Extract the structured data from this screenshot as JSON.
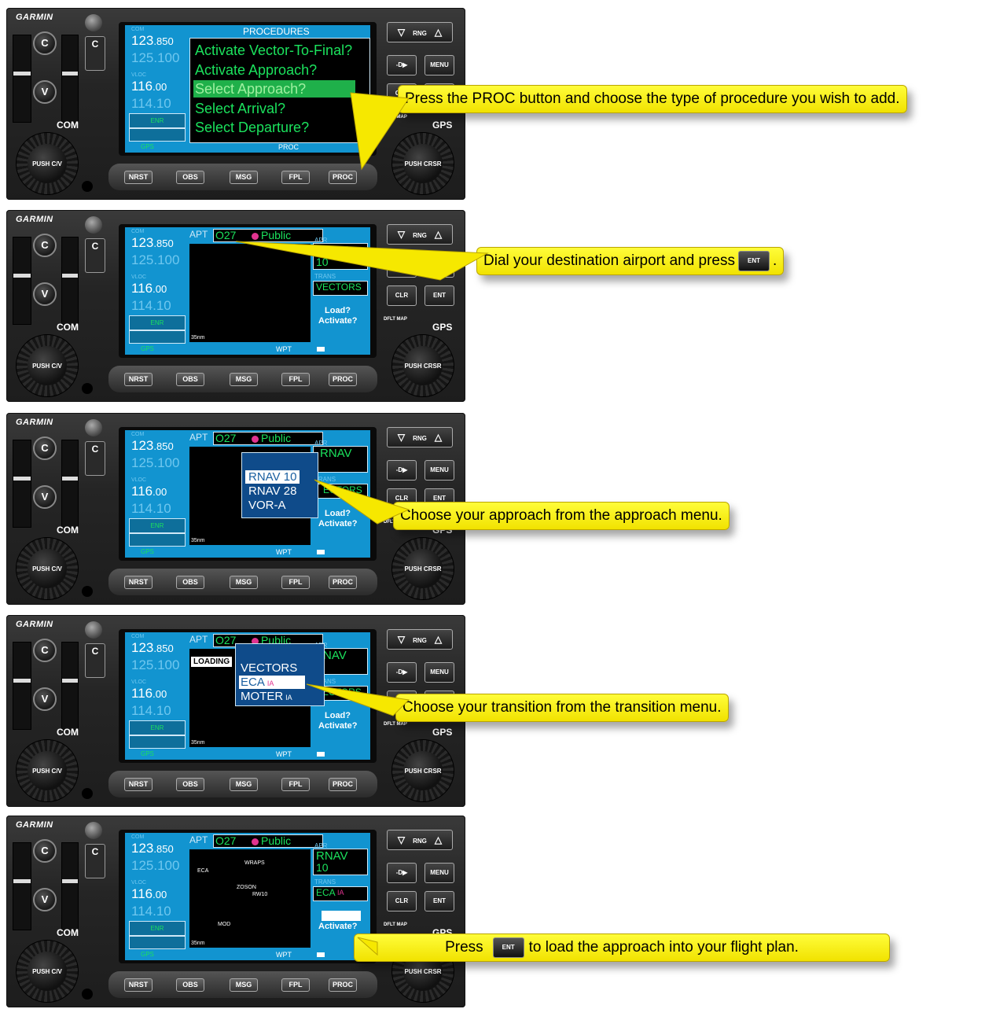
{
  "brand": "GARMIN",
  "labels": {
    "com": "COM",
    "gps": "GPS",
    "push_cv": "PUSH C/V",
    "push_crsr": "PUSH CRSR",
    "c_knob": "C",
    "v_knob": "V",
    "c_switch": "C",
    "rng": "RNG",
    "dto": "-D▶",
    "menu": "MENU",
    "clr": "CLR",
    "ent": "ENT",
    "dflt_map": "DFLT MAP",
    "com_small": "COM",
    "vloc_small": "VLOC",
    "enr": "ENR",
    "gps_small": "GPS",
    "apt": "APT",
    "public": "Public",
    "load": "Load?",
    "activate": "Activate?",
    "wpt": "WPT",
    "scale": "35nm",
    "proc_tab": "PROC",
    "apr": "APR",
    "trans": "TRANS",
    "loading": "LOADING"
  },
  "softkeys": [
    "NRST",
    "OBS",
    "MSG",
    "FPL",
    "PROC"
  ],
  "frequencies": {
    "com_active": "123",
    "com_active_dec": ".850",
    "com_standby": "125.100",
    "vloc_active": "116",
    "vloc_active_dec": ".00",
    "vloc_standby": "114.10"
  },
  "panel1": {
    "header": "PROCEDURES",
    "items": [
      "Activate Vector-To-Final?",
      "Activate Approach?",
      "Select Approach?",
      "Select Arrival?",
      "Select Departure?"
    ],
    "selected_index": 2,
    "callout": "Press the PROC button and choose the type of procedure you wish to add."
  },
  "panel2": {
    "airport": "O27",
    "approach": "RNAV",
    "approach_rwy": "10",
    "transition": "VECTORS",
    "callout_prefix": "Dial your destination airport and press",
    "callout_key": "ENT",
    "callout_suffix": "."
  },
  "panel3": {
    "airport": "O27",
    "menu_items": [
      "RNAV 10",
      "RNAV 28",
      "VOR-A"
    ],
    "approach": "RNAV",
    "approach_rwy": "0",
    "transition": "ECTORS",
    "callout": "Choose your approach from the approach menu."
  },
  "panel4": {
    "airport": "O27",
    "menu_items": [
      "VECTORS",
      "ECA",
      "MOTER"
    ],
    "menu_suffix": "IA",
    "approach": "NAV",
    "transition": "VECTORS",
    "callout": "Choose your transition from the transition menu."
  },
  "panel5": {
    "airport": "O27",
    "approach": "RNAV",
    "approach_rwy": "10",
    "transition": "ECA",
    "transition_suffix": "IA",
    "waypoints": [
      "WRAPS",
      "ECA",
      "ZOSON",
      "RW10",
      "MOD"
    ],
    "callout_prefix": "Press",
    "callout_key": "ENT",
    "callout_suffix": "to load the approach into your flight plan."
  },
  "colors": {
    "screen_blue": "#1294d0",
    "nav_green": "#1be25d",
    "callout_yellow": "#fffd3a",
    "selection_magenta": "#e0338f"
  }
}
